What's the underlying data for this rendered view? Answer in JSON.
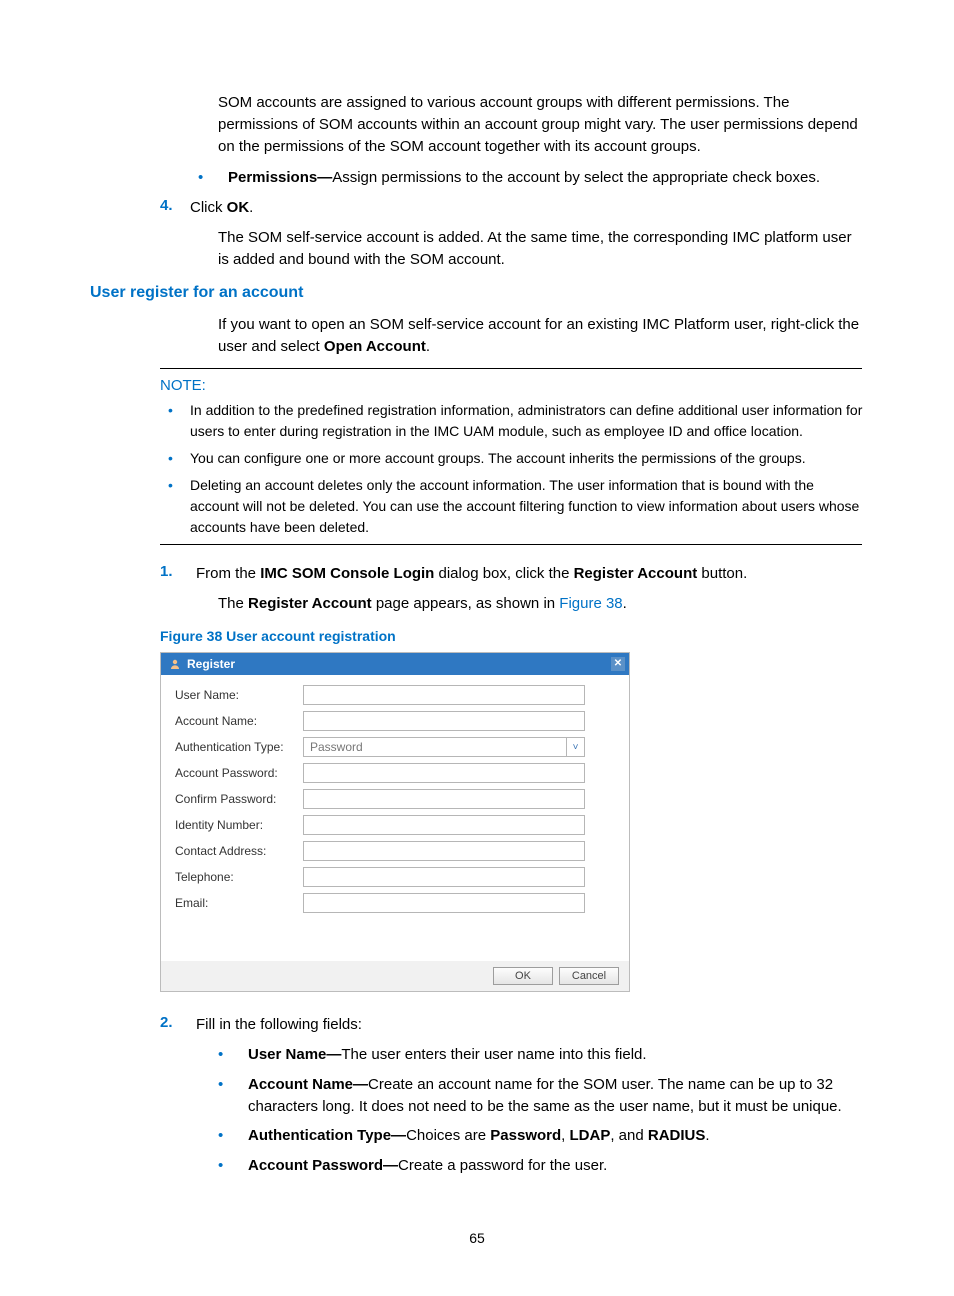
{
  "intro": {
    "p1": "SOM accounts are assigned to various account groups with different permissions. The permissions of SOM accounts within an account group might vary. The user permissions depend on the permissions of the SOM account together with its account groups.",
    "permissions_label": "Permissions—",
    "permissions_text": "Assign permissions to the account by select the appropriate check boxes."
  },
  "step4": {
    "num": "4.",
    "text_prefix": "Click ",
    "text_bold": "OK",
    "text_suffix": ".",
    "after": "The SOM self-service account is added. At the same time, the corresponding IMC platform user is added and bound with the SOM account."
  },
  "section_heading": "User register for an account",
  "section_intro_prefix": "If you want to open an SOM self-service account for an existing IMC Platform user, right-click the user and select ",
  "section_intro_bold": "Open Account",
  "section_intro_suffix": ".",
  "note": {
    "label": "NOTE:",
    "items": [
      "In addition to the predefined registration information, administrators can define additional user information for users to enter during registration in the IMC UAM module, such as employee ID and office location.",
      "You can configure one or more account groups. The account inherits the permissions of the groups.",
      "Deleting an account deletes only the account information. The user information that is bound with the account will not be deleted. You can use the account filtering function to view information about users whose accounts have been deleted."
    ]
  },
  "step1": {
    "num": "1.",
    "text_a": "From the ",
    "text_b1": "IMC SOM Console Login",
    "text_c": " dialog box, click the ",
    "text_b2": "Register Account",
    "text_d": " button.",
    "after_a": "The ",
    "after_b": "Register Account",
    "after_c": " page appears, as shown in ",
    "after_link": "Figure 38",
    "after_d": "."
  },
  "figure_caption": "Figure 38 User account registration",
  "dialog": {
    "title": "Register",
    "fields": {
      "user_name": "User Name:",
      "account_name": "Account Name:",
      "auth_type": "Authentication Type:",
      "auth_type_value": "Password",
      "account_password": "Account Password:",
      "confirm_password": "Confirm Password:",
      "identity_number": "Identity Number:",
      "contact_address": "Contact Address:",
      "telephone": "Telephone:",
      "email": "Email:"
    },
    "ok": "OK",
    "cancel": "Cancel"
  },
  "step2": {
    "num": "2.",
    "text": "Fill in the following fields:",
    "items": [
      {
        "label": "User Name—",
        "text": "The user enters their user name into this field."
      },
      {
        "label": "Account Name—",
        "text": "Create an account name for the SOM user. The name can be up to 32 characters long. It does not need to be the same as the user name, but it must be unique."
      },
      {
        "label": "Authentication Type—",
        "text_a": "Choices are ",
        "b1": "Password",
        "c1": ", ",
        "b2": "LDAP",
        "c2": ", and ",
        "b3": "RADIUS",
        "c3": "."
      },
      {
        "label": "Account Password—",
        "text": "Create a password for the user."
      }
    ]
  },
  "page_number": "65"
}
